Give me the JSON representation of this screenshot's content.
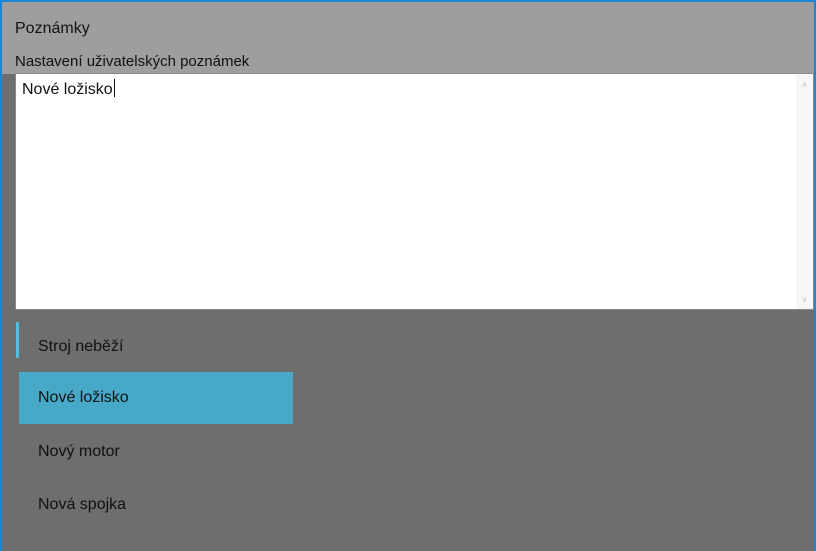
{
  "header": {
    "title": "Poznámky",
    "subtitle": "Nastavení uživatelských poznámek"
  },
  "note_editor": {
    "value": "Nové ložisko"
  },
  "scrollbar": {
    "up_icon": "chevron-up-icon",
    "down_icon": "chevron-down-icon"
  },
  "note_list": {
    "items": [
      {
        "label": "Stroj neběží"
      },
      {
        "label": "Nové ložisko"
      },
      {
        "label": "Nový motor"
      },
      {
        "label": "Nová spojka"
      }
    ],
    "selected_label": "Nové ložisko"
  },
  "colors": {
    "window_border": "#1b86d6",
    "header_background": "#9e9e9e",
    "list_background": "#6e6e6e",
    "selected_item": "#47a9c7",
    "focus_marker": "#55bde0"
  }
}
